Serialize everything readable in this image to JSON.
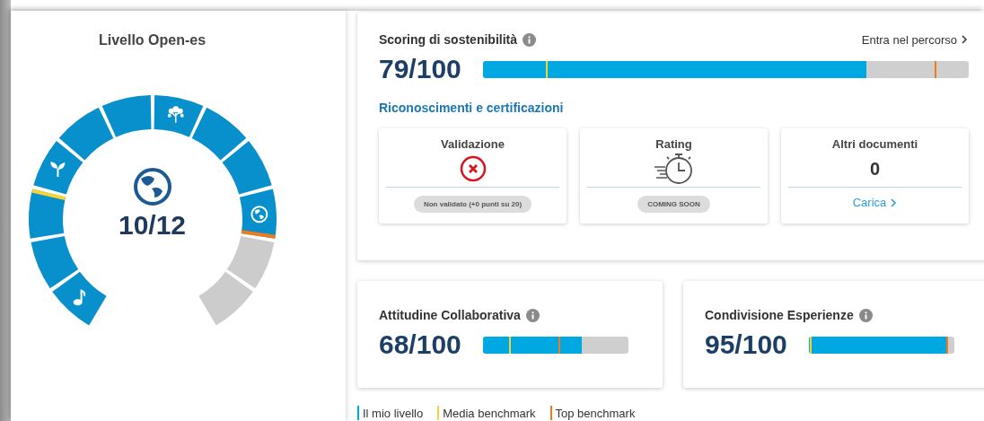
{
  "gauge": {
    "title": "Livello Open-es",
    "value": "10/12",
    "segments": [
      {
        "kind": "plain",
        "filled": true
      },
      {
        "kind": "plain",
        "filled": true
      },
      {
        "kind": "media",
        "filled": true
      },
      {
        "kind": "plain",
        "filled": true
      },
      {
        "kind": "plain",
        "filled": true
      },
      {
        "kind": "plain",
        "filled": true
      },
      {
        "kind": "plain",
        "filled": true
      },
      {
        "kind": "plain",
        "filled": true
      },
      {
        "kind": "plain",
        "filled": true
      },
      {
        "kind": "top",
        "filled": true
      },
      {
        "kind": "plain",
        "filled": false
      },
      {
        "kind": "plain",
        "filled": false
      }
    ]
  },
  "sustainability": {
    "title": "Scoring di sostenibilità",
    "link": "Entra nel percorso",
    "score": "79/100",
    "bar": {
      "level": 0.79,
      "benchmarks": [
        {
          "kind": "media",
          "level": 0.13
        },
        {
          "kind": "top",
          "level": 0.93
        }
      ]
    },
    "section_title": "Riconoscimenti e certificazioni",
    "cards": [
      {
        "kind": "validation",
        "title": "Validazione",
        "status": "Non validato (+0 punti su 20)"
      },
      {
        "kind": "rating",
        "title": "Rating",
        "status": "COMING SOON"
      },
      {
        "kind": "documents",
        "title": "Altri documenti",
        "count": "0",
        "link": "Carica"
      }
    ]
  },
  "scores": [
    {
      "title": "Attitudine Collaborativa",
      "score": "68/100",
      "bar": {
        "level": 0.68,
        "benchmarks": [
          {
            "kind": "media",
            "level": 0.18
          },
          {
            "kind": "top",
            "level": 0.52
          }
        ]
      }
    },
    {
      "title": "Condivisione Esperienze",
      "score": "95/100",
      "bar": {
        "level": 0.95,
        "benchmarks": [
          {
            "kind": "media",
            "level": 0.005
          },
          {
            "kind": "top",
            "level": 0.945
          }
        ]
      }
    }
  ],
  "legend": [
    {
      "kind": "mine",
      "label": "Il mio livello",
      "color": "#00a8e1"
    },
    {
      "kind": "media",
      "label": "Media benchmark",
      "color": "#f5d33a"
    },
    {
      "kind": "top",
      "label": "Top benchmark",
      "color": "#f07a1e"
    }
  ]
}
